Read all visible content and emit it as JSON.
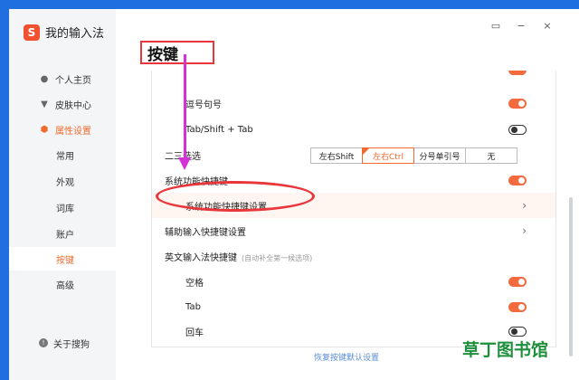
{
  "app": {
    "title": "我的输入法",
    "logo_char": "S"
  },
  "window": {
    "skin_icon": "▭",
    "minimize": "−",
    "close": "×"
  },
  "sidebar": {
    "items": [
      {
        "label": "个人主页",
        "icon": "person-icon",
        "glyph": "●"
      },
      {
        "label": "皮肤中心",
        "icon": "shirt-icon",
        "glyph": "▼"
      },
      {
        "label": "属性设置",
        "icon": "settings-icon",
        "glyph": "⬢"
      },
      {
        "label": "常用"
      },
      {
        "label": "外观"
      },
      {
        "label": "词库"
      },
      {
        "label": "账户"
      },
      {
        "label": "按键"
      },
      {
        "label": "高级"
      }
    ],
    "about": {
      "label": "关于搜狗",
      "glyph": "!"
    }
  },
  "page": {
    "title": "按键"
  },
  "settings": {
    "row_comma": {
      "label": "逗号句号"
    },
    "row_tab": {
      "label": "Tab/Shift + Tab"
    },
    "row_candidate": {
      "label": "二三选选",
      "options": [
        "左右Shift",
        "左右Ctrl",
        "分号单引号",
        "无"
      ],
      "selected": "左右Ctrl"
    },
    "row_sys_shortcut": {
      "label": "系统功能快捷键"
    },
    "row_sys_shortcut_settings": {
      "label": "系统功能快捷键设置",
      "chevron": "›"
    },
    "row_aux": {
      "label": "辅助输入快捷键设置",
      "chevron": "›"
    },
    "row_en": {
      "label": "英文输入法快捷键",
      "hint": "(自动补全第一候选项)"
    },
    "row_space": {
      "label": "空格"
    },
    "row_tabkey": {
      "label": "Tab"
    },
    "row_enter": {
      "label": "回车"
    }
  },
  "toggles": {
    "comma": "on",
    "tab": "off",
    "sys": "on",
    "space": "on",
    "tabkey": "on",
    "enter": "off"
  },
  "footer": {
    "restore": "恢复按键默认设置"
  },
  "watermark": {
    "text": "草丁图书馆"
  },
  "colors": {
    "accent": "#f06a2c",
    "annotation_red": "#e8363a",
    "annotation_magenta": "#d531d8",
    "desktop": "#1f6fe0"
  }
}
